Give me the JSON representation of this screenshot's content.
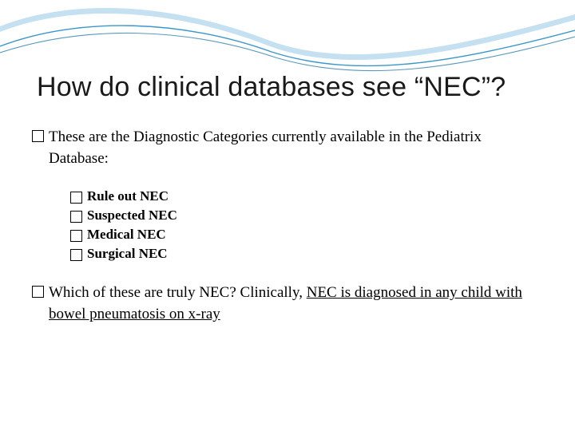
{
  "title": "How do clinical databases see “NEC”?",
  "intro": "These are the Diagnostic Categories currently available in the Pediatrix Database:",
  "categories": {
    "c0": "Rule out NEC",
    "c1": "Suspected NEC",
    "c2": "Medical NEC",
    "c3": "Surgical NEC"
  },
  "closing_lead": "Which of these are truly NEC? Clinically, ",
  "closing_underlined": "NEC is diagnosed in any child with bowel pneumatosis on x-ray"
}
